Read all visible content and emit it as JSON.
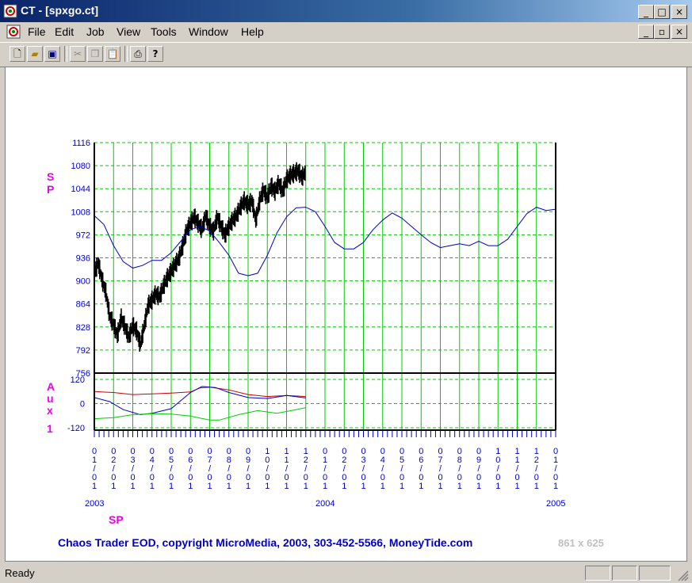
{
  "window": {
    "title": "CT - [spxgo.ct]",
    "controls": {
      "minimize": "_",
      "maximize": "□",
      "close": "×"
    },
    "child_controls": {
      "minimize": "_",
      "restore": "▫",
      "close": "×"
    }
  },
  "menu": [
    "File",
    "Edit",
    "Job",
    "View",
    "Tools",
    "Window",
    "Help"
  ],
  "toolbar": [
    "new-icon",
    "open-icon",
    "save-icon",
    "cut-icon",
    "copy-icon",
    "paste-icon",
    "print-icon",
    "help-icon"
  ],
  "status": {
    "text": "Ready"
  },
  "chart_data": {
    "type": "line",
    "colors": {
      "grid": "#00cc00",
      "axis_text": "#0000cc",
      "label_magenta": "#ee00ee",
      "price": "#000000",
      "blue": "#0000cc",
      "red": "#cc0000",
      "green": "#00cc00"
    },
    "upper_panel": {
      "label": "SP",
      "yticks": [
        "1116",
        "1080",
        "1044",
        "1008",
        "972",
        "936",
        "900",
        "864",
        "828",
        "792",
        "756"
      ],
      "ylim": [
        756,
        1116
      ],
      "price_series": [
        {
          "m": 0.0,
          "y": 912
        },
        {
          "m": 0.2,
          "y": 928
        },
        {
          "m": 0.4,
          "y": 902
        },
        {
          "m": 0.6,
          "y": 882
        },
        {
          "m": 0.8,
          "y": 845
        },
        {
          "m": 1.0,
          "y": 832
        },
        {
          "m": 1.2,
          "y": 815
        },
        {
          "m": 1.4,
          "y": 842
        },
        {
          "m": 1.6,
          "y": 828
        },
        {
          "m": 1.8,
          "y": 812
        },
        {
          "m": 2.0,
          "y": 830
        },
        {
          "m": 2.2,
          "y": 822
        },
        {
          "m": 2.4,
          "y": 800
        },
        {
          "m": 2.6,
          "y": 830
        },
        {
          "m": 2.8,
          "y": 862
        },
        {
          "m": 3.0,
          "y": 870
        },
        {
          "m": 3.2,
          "y": 880
        },
        {
          "m": 3.4,
          "y": 875
        },
        {
          "m": 3.6,
          "y": 892
        },
        {
          "m": 3.8,
          "y": 905
        },
        {
          "m": 4.0,
          "y": 915
        },
        {
          "m": 4.2,
          "y": 925
        },
        {
          "m": 4.4,
          "y": 935
        },
        {
          "m": 4.6,
          "y": 955
        },
        {
          "m": 4.8,
          "y": 978
        },
        {
          "m": 5.0,
          "y": 990
        },
        {
          "m": 5.2,
          "y": 1000
        },
        {
          "m": 5.4,
          "y": 990
        },
        {
          "m": 5.6,
          "y": 980
        },
        {
          "m": 5.8,
          "y": 1002
        },
        {
          "m": 6.0,
          "y": 985
        },
        {
          "m": 6.2,
          "y": 978
        },
        {
          "m": 6.4,
          "y": 1000
        },
        {
          "m": 6.6,
          "y": 985
        },
        {
          "m": 6.8,
          "y": 972
        },
        {
          "m": 7.0,
          "y": 985
        },
        {
          "m": 7.2,
          "y": 995
        },
        {
          "m": 7.4,
          "y": 1002
        },
        {
          "m": 7.6,
          "y": 1015
        },
        {
          "m": 7.8,
          "y": 1025
        },
        {
          "m": 8.0,
          "y": 1018
        },
        {
          "m": 8.2,
          "y": 1025
        },
        {
          "m": 8.4,
          "y": 995
        },
        {
          "m": 8.6,
          "y": 1025
        },
        {
          "m": 8.8,
          "y": 1042
        },
        {
          "m": 9.0,
          "y": 1030
        },
        {
          "m": 9.2,
          "y": 1048
        },
        {
          "m": 9.4,
          "y": 1040
        },
        {
          "m": 9.6,
          "y": 1053
        },
        {
          "m": 9.8,
          "y": 1040
        },
        {
          "m": 10.0,
          "y": 1058
        },
        {
          "m": 10.2,
          "y": 1065
        },
        {
          "m": 10.4,
          "y": 1068
        },
        {
          "m": 10.6,
          "y": 1072
        },
        {
          "m": 10.8,
          "y": 1062
        },
        {
          "m": 11.0,
          "y": 1070
        }
      ],
      "blue_series": [
        {
          "m": 0.0,
          "y": 1002
        },
        {
          "m": 0.5,
          "y": 988
        },
        {
          "m": 1.0,
          "y": 955
        },
        {
          "m": 1.5,
          "y": 930
        },
        {
          "m": 2.0,
          "y": 920
        },
        {
          "m": 2.5,
          "y": 924
        },
        {
          "m": 3.0,
          "y": 932
        },
        {
          "m": 3.5,
          "y": 932
        },
        {
          "m": 4.0,
          "y": 944
        },
        {
          "m": 4.5,
          "y": 962
        },
        {
          "m": 5.0,
          "y": 980
        },
        {
          "m": 5.5,
          "y": 985
        },
        {
          "m": 6.0,
          "y": 978
        },
        {
          "m": 6.5,
          "y": 960
        },
        {
          "m": 7.0,
          "y": 940
        },
        {
          "m": 7.5,
          "y": 912
        },
        {
          "m": 8.0,
          "y": 908
        },
        {
          "m": 8.5,
          "y": 912
        },
        {
          "m": 9.0,
          "y": 940
        },
        {
          "m": 9.5,
          "y": 975
        },
        {
          "m": 10.0,
          "y": 1000
        },
        {
          "m": 10.5,
          "y": 1014
        },
        {
          "m": 11.0,
          "y": 1015
        },
        {
          "m": 11.5,
          "y": 1008
        },
        {
          "m": 12.0,
          "y": 985
        },
        {
          "m": 12.5,
          "y": 960
        },
        {
          "m": 13.0,
          "y": 950
        },
        {
          "m": 13.5,
          "y": 950
        },
        {
          "m": 14.0,
          "y": 960
        },
        {
          "m": 14.5,
          "y": 980
        },
        {
          "m": 15.0,
          "y": 995
        },
        {
          "m": 15.5,
          "y": 1006
        },
        {
          "m": 16.0,
          "y": 998
        },
        {
          "m": 16.5,
          "y": 985
        },
        {
          "m": 17.0,
          "y": 972
        },
        {
          "m": 17.5,
          "y": 960
        },
        {
          "m": 18.0,
          "y": 952
        },
        {
          "m": 18.5,
          "y": 955
        },
        {
          "m": 19.0,
          "y": 958
        },
        {
          "m": 19.5,
          "y": 955
        },
        {
          "m": 20.0,
          "y": 962
        },
        {
          "m": 20.5,
          "y": 955
        },
        {
          "m": 21.0,
          "y": 955
        },
        {
          "m": 21.5,
          "y": 965
        },
        {
          "m": 22.0,
          "y": 985
        },
        {
          "m": 22.5,
          "y": 1005
        },
        {
          "m": 23.0,
          "y": 1015
        },
        {
          "m": 23.5,
          "y": 1010
        },
        {
          "m": 24.0,
          "y": 1012
        }
      ]
    },
    "lower_panel": {
      "label": "Aux 1",
      "yticks": [
        "120",
        "0",
        "-120"
      ],
      "ylim": [
        -120,
        120
      ],
      "red_series": [
        {
          "m": 0.0,
          "y": 60
        },
        {
          "m": 1.0,
          "y": 55
        },
        {
          "m": 2.0,
          "y": 45
        },
        {
          "m": 3.0,
          "y": 48
        },
        {
          "m": 4.0,
          "y": 52
        },
        {
          "m": 5.0,
          "y": 58
        },
        {
          "m": 5.5,
          "y": 78
        },
        {
          "m": 6.0,
          "y": 82
        },
        {
          "m": 7.0,
          "y": 68
        },
        {
          "m": 8.0,
          "y": 45
        },
        {
          "m": 9.0,
          "y": 35
        },
        {
          "m": 10.0,
          "y": 40
        },
        {
          "m": 11.0,
          "y": 35
        }
      ],
      "blue_series": [
        {
          "m": 0.0,
          "y": 30
        },
        {
          "m": 0.8,
          "y": 10
        },
        {
          "m": 1.5,
          "y": -30
        },
        {
          "m": 2.4,
          "y": -55
        },
        {
          "m": 3.0,
          "y": -48
        },
        {
          "m": 4.0,
          "y": -25
        },
        {
          "m": 4.5,
          "y": 15
        },
        {
          "m": 5.0,
          "y": 55
        },
        {
          "m": 5.6,
          "y": 85
        },
        {
          "m": 6.3,
          "y": 80
        },
        {
          "m": 7.0,
          "y": 55
        },
        {
          "m": 8.0,
          "y": 30
        },
        {
          "m": 9.0,
          "y": 25
        },
        {
          "m": 10.0,
          "y": 40
        },
        {
          "m": 11.0,
          "y": 28
        }
      ],
      "green_series": [
        {
          "m": 0.0,
          "y": -75
        },
        {
          "m": 1.0,
          "y": -70
        },
        {
          "m": 2.0,
          "y": -55
        },
        {
          "m": 3.0,
          "y": -50
        },
        {
          "m": 4.0,
          "y": -52
        },
        {
          "m": 5.0,
          "y": -62
        },
        {
          "m": 6.0,
          "y": -82
        },
        {
          "m": 6.5,
          "y": -82
        },
        {
          "m": 7.5,
          "y": -55
        },
        {
          "m": 8.5,
          "y": -35
        },
        {
          "m": 9.5,
          "y": -48
        },
        {
          "m": 10.5,
          "y": -30
        },
        {
          "m": 11.0,
          "y": -20
        }
      ]
    },
    "months": [
      "01",
      "02",
      "03",
      "04",
      "05",
      "06",
      "07",
      "08",
      "09",
      "10",
      "11",
      "12",
      "01",
      "02",
      "03",
      "04",
      "05",
      "06",
      "07",
      "08",
      "09",
      "10",
      "11",
      "12",
      "01"
    ],
    "year_labels": [
      {
        "index": 0,
        "text": "2003"
      },
      {
        "index": 12,
        "text": "2004"
      },
      {
        "index": 24,
        "text": "2005"
      }
    ],
    "symbol_label": "SP",
    "copyright": "Chaos Trader EOD, copyright MicroMedia, 2003, 303-452-5566, MoneyTide.com",
    "size_label": "861 x 625"
  }
}
